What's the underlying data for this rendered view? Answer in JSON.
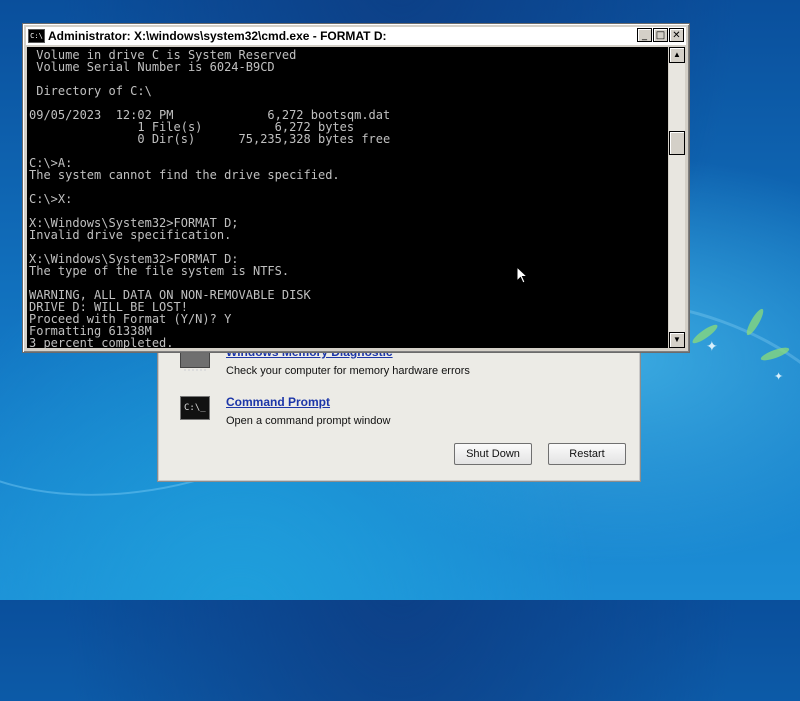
{
  "cmd_window": {
    "title": "Administrator: X:\\windows\\system32\\cmd.exe - FORMAT  D:",
    "icon_text": "C:\\",
    "buttons": {
      "minimize": "_",
      "maximize": "□",
      "close": "✕"
    },
    "console_lines": [
      " Volume in drive C is System Reserved",
      " Volume Serial Number is 6024-B9CD",
      "",
      " Directory of C:\\",
      "",
      "09/05/2023  12:02 PM             6,272 bootsqm.dat",
      "               1 File(s)          6,272 bytes",
      "               0 Dir(s)      75,235,328 bytes free",
      "",
      "C:\\>A:",
      "The system cannot find the drive specified.",
      "",
      "C:\\>X:",
      "",
      "X:\\Windows\\System32>FORMAT D;",
      "Invalid drive specification.",
      "",
      "X:\\Windows\\System32>FORMAT D:",
      "The type of the file system is NTFS.",
      "",
      "WARNING, ALL DATA ON NON-REMOVABLE DISK",
      "DRIVE D: WILL BE LOST!",
      "Proceed with Format (Y/N)? Y",
      "Formatting 61338M",
      "3 percent completed."
    ]
  },
  "recovery": {
    "tools": [
      {
        "title": "Windows Memory Diagnostic",
        "description": "Check your computer for memory hardware errors",
        "icon": "memory-chip-icon"
      },
      {
        "title": "Command Prompt",
        "description": "Open a command prompt window",
        "icon": "command-prompt-icon",
        "icon_text": "C:\\_"
      }
    ],
    "shutdown_label": "Shut Down",
    "restart_label": "Restart"
  }
}
